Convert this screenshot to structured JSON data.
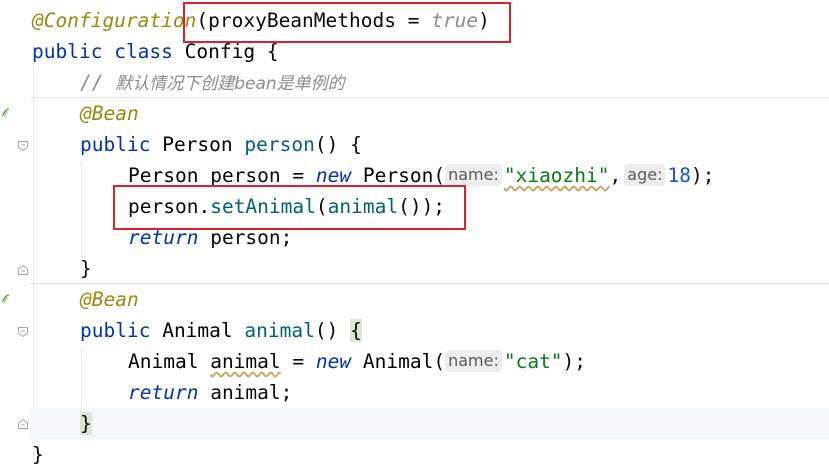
{
  "code": {
    "l1": {
      "annotation": "@Configuration",
      "open": "(",
      "param": "proxyBeanMethods",
      "eq": " = ",
      "value": "true",
      "close": ")"
    },
    "l2": {
      "kw1": "public",
      "kw2": "class",
      "name": "Config",
      "brace": "{"
    },
    "l3": {
      "slashes": "// ",
      "text": "默认情况下创建bean是单例的"
    },
    "l4": {
      "annotation": "@Bean"
    },
    "l5": {
      "kw": "public",
      "type": "Person",
      "method": "person",
      "parens": "()",
      "brace": "{"
    },
    "l6": {
      "type": "Person",
      "var": "person",
      "eq": " = ",
      "new": "new",
      "ctor": "Person",
      "open": "(",
      "hint1": "name:",
      "str": "\"xiaozhi\"",
      "comma": ",",
      "hint2": "age:",
      "num": "18",
      "close": ");"
    },
    "l7": {
      "obj": "person",
      "dot": ".",
      "method": "setAnimal",
      "open": "(",
      "call": "animal",
      "callparens": "()",
      "close": ");"
    },
    "l8": {
      "kw": "return",
      "var": "person",
      "semi": ";"
    },
    "l9": {
      "brace": "}"
    },
    "l10": {
      "annotation": "@Bean"
    },
    "l11": {
      "kw": "public",
      "type": "Animal",
      "method": "animal",
      "parens": "()",
      "brace": "{"
    },
    "l12": {
      "type": "Animal",
      "var": "animal",
      "eq": " = ",
      "new": "new",
      "ctor": "Animal",
      "open": "(",
      "hint1": "name:",
      "str": "\"cat\"",
      "close": ");"
    },
    "l13": {
      "kw": "return",
      "var": "animal",
      "semi": ";"
    },
    "l14": {
      "brace": "}"
    },
    "l15": {
      "brace": "}"
    }
  },
  "colors": {
    "keyword": "#0033B3",
    "annotation": "#9E880D",
    "comment": "#8C8C8C",
    "method": "#00627A",
    "string": "#067D17",
    "number": "#1750EB",
    "highlight_box": "#E0202A"
  },
  "icons": [
    "bean-gutter-icon",
    "fold-marker-icon"
  ]
}
